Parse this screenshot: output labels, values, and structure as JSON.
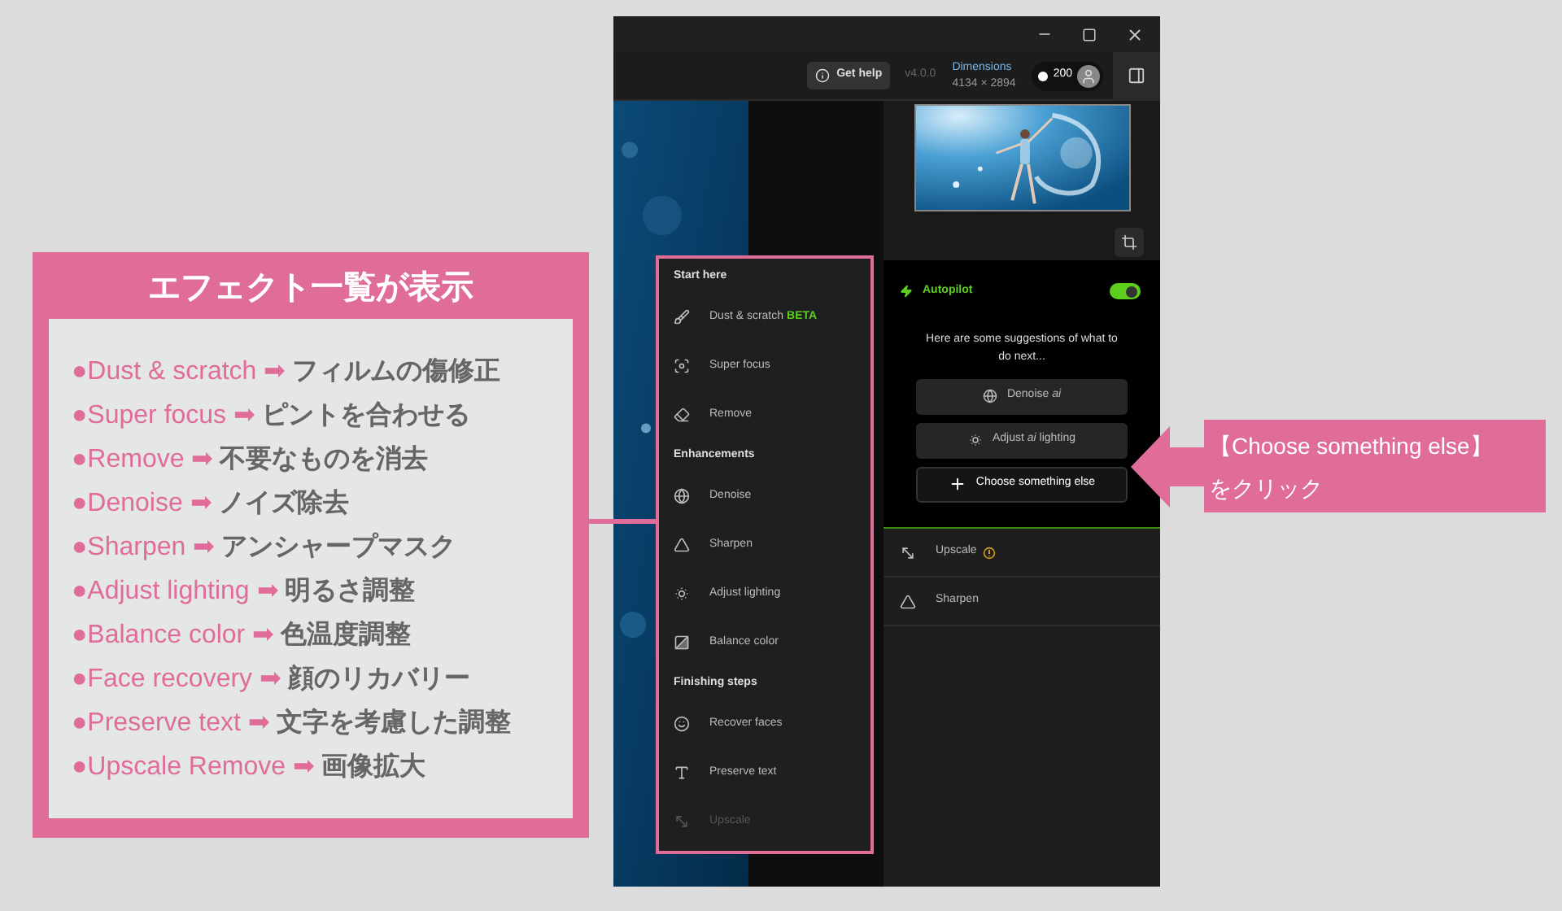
{
  "toolbar": {
    "help_button": "Get help",
    "version": "v4.0.0",
    "dimensions_label": "Dimensions",
    "dimensions_value": "4134 × 2894",
    "credits": "200"
  },
  "effects_menu": {
    "sections": [
      {
        "title": "Start here",
        "items": [
          {
            "label": "Dust & scratch",
            "badge": "BETA",
            "disabled": false
          },
          {
            "label": "Super focus",
            "disabled": false
          },
          {
            "label": "Remove",
            "disabled": false
          }
        ]
      },
      {
        "title": "Enhancements",
        "items": [
          {
            "label": "Denoise",
            "disabled": false
          },
          {
            "label": "Sharpen",
            "disabled": false
          },
          {
            "label": "Adjust lighting",
            "disabled": false
          },
          {
            "label": "Balance color",
            "disabled": false
          }
        ]
      },
      {
        "title": "Finishing steps",
        "items": [
          {
            "label": "Recover faces",
            "disabled": false
          },
          {
            "label": "Preserve text",
            "disabled": false
          },
          {
            "label": "Upscale",
            "disabled": true
          }
        ]
      }
    ]
  },
  "autopilot": {
    "label": "Autopilot",
    "on": true,
    "message": "Here are some suggestions of what to do next...",
    "suggestions": [
      {
        "kind": "effect",
        "text": "Denoise *ai*"
      },
      {
        "kind": "effect",
        "text": "Adjust *ai* lighting"
      },
      {
        "kind": "add",
        "text": "Choose something else"
      }
    ]
  },
  "applied_effects": [
    {
      "label": "Upscale",
      "warning": true
    },
    {
      "label": "Sharpen",
      "warning": false
    }
  ],
  "annotation": {
    "title": "エフェクト一覧が表示",
    "lines": [
      {
        "bullet": "●",
        "term": "Dust & scratch",
        "arrow": "➡",
        "desc": "フィルムの傷修正"
      },
      {
        "bullet": "●",
        "term": "Super focus",
        "arrow": "➡",
        "desc": "ピントを合わせる"
      },
      {
        "bullet": "●",
        "term": "Remove",
        "arrow": "➡",
        "desc": "不要なものを消去"
      },
      {
        "bullet": "●",
        "term": "Denoise",
        "arrow": "➡",
        "desc": "ノイズ除去"
      },
      {
        "bullet": "●",
        "term": "Sharpen",
        "arrow": "➡",
        "desc": "アンシャープマスク"
      },
      {
        "bullet": "●",
        "term": "Adjust lighting",
        "arrow": "➡",
        "desc": "明るさ調整"
      },
      {
        "bullet": "●",
        "term": "Balance color",
        "arrow": "➡",
        "desc": "色温度調整"
      },
      {
        "bullet": "●",
        "term": "Face recovery",
        "arrow": "➡",
        "desc": "顔のリカバリー"
      },
      {
        "bullet": "●",
        "term": "Preserve text",
        "arrow": "➡",
        "desc": "文字を考慮した調整"
      },
      {
        "bullet": "●",
        "term": "Upscale Remove",
        "arrow": "➡",
        "desc": "画像拡大"
      }
    ]
  },
  "callout": {
    "lines": [
      "【Choose something else】",
      "をクリック"
    ]
  }
}
